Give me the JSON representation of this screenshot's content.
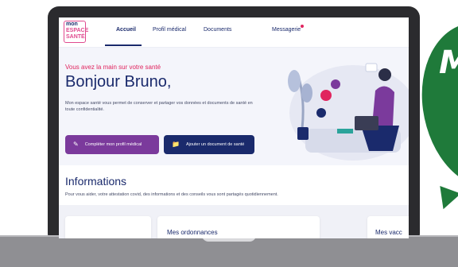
{
  "badge": {
    "letter": "M"
  },
  "nav": {
    "logo_lines": [
      "mon",
      "ESPACE",
      "SANTÉ"
    ],
    "tabs": [
      {
        "label": "Accueil",
        "active": true
      },
      {
        "label": "Profil médical",
        "active": false
      },
      {
        "label": "Documents",
        "active": false
      },
      {
        "label": "Messagerie",
        "active": false,
        "notification": true
      }
    ]
  },
  "hero": {
    "tagline": "Vous avez la main sur votre santé",
    "greeting": "Bonjour Bruno,",
    "intro": "Mon espace santé vous permet de conserver et partager vos données et documents de santé en toute confidentialité.",
    "buttons": {
      "profile": "Compléter mon profil médical",
      "upload": "Ajouter un document de santé"
    }
  },
  "informations": {
    "title": "Informations",
    "text": "Pour vous aider, votre attestation covid, des informations et des conseils vous sont partagés quotidiennement."
  },
  "cards": [
    {
      "title": ""
    },
    {
      "title": "Mes ordonnances"
    },
    {
      "title": "Mes vacc"
    }
  ],
  "colors": {
    "primary": "#1a2a6c",
    "accent": "#e0245e",
    "profile_button": "#7b3a9c",
    "badge": "#1f7a3a"
  }
}
